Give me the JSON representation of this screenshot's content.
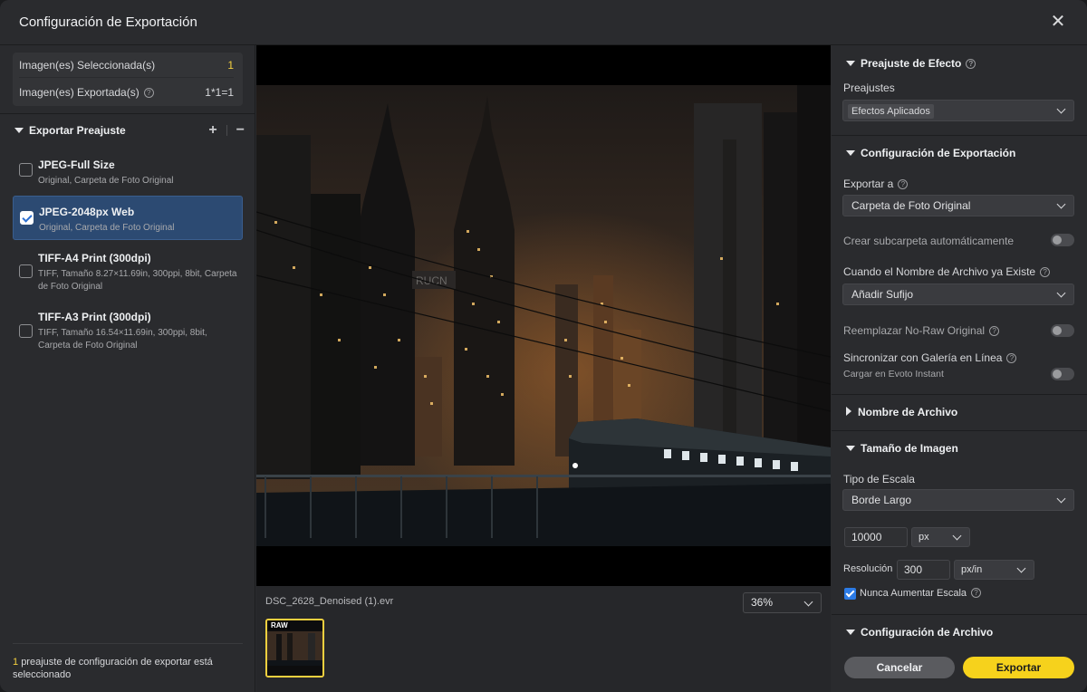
{
  "window": {
    "title": "Configuración de Exportación"
  },
  "selection": {
    "selected_label": "Imagen(es) Seleccionada(s)",
    "selected_value": "1",
    "exported_label": "Imagen(es) Exportada(s)",
    "exported_value": "1*1=1"
  },
  "presets": {
    "header": "Exportar Preajuste",
    "items": [
      {
        "name": "JPEG-Full Size",
        "desc": "Original, Carpeta de Foto Original",
        "checked": false
      },
      {
        "name": "JPEG-2048px Web",
        "desc": "Original, Carpeta de Foto Original",
        "checked": true
      },
      {
        "name": "TIFF-A4 Print (300dpi)",
        "desc": "TIFF, Tamaño 8.27×11.69in, 300ppi, 8bit, Carpeta de Foto Original",
        "checked": false
      },
      {
        "name": "TIFF-A3 Print (300dpi)",
        "desc": "TIFF, Tamaño 16.54×11.69in, 300ppi, 8bit, Carpeta de Foto Original",
        "checked": false
      }
    ],
    "footer_count": "1",
    "footer_text": "preajuste de configuración de exportar está seleccionado"
  },
  "viewer": {
    "filename": "DSC_2628_Denoised (1).evr",
    "zoom": "36%",
    "thumb_badge": "RAW"
  },
  "effect": {
    "header": "Preajuste de Efecto",
    "presets_label": "Preajustes",
    "presets_value": "Efectos Aplicados"
  },
  "export_config": {
    "header": "Configuración de Exportación",
    "export_to_label": "Exportar a",
    "export_to_value": "Carpeta de Foto Original",
    "subfolder_label": "Crear subcarpeta automáticamente",
    "exists_label": "Cuando el Nombre de Archivo ya Existe",
    "exists_value": "Añadir Sufijo",
    "replace_label": "Reemplazar No-Raw Original",
    "sync_label": "Sincronizar con Galería en Línea",
    "sync_sub": "Cargar en Evoto Instant"
  },
  "file_name": {
    "header": "Nombre de Archivo"
  },
  "image_size": {
    "header": "Tamaño de Imagen",
    "scale_type_label": "Tipo de Escala",
    "scale_type_value": "Borde Largo",
    "size_value": "10000",
    "size_unit": "px",
    "resolution_label": "Resolución",
    "resolution_value": "300",
    "resolution_unit": "px/in",
    "never_enlarge_label": "Nunca Aumentar Escala"
  },
  "file_config": {
    "header": "Configuración de Archivo"
  },
  "buttons": {
    "cancel": "Cancelar",
    "export": "Exportar"
  },
  "photo_sign": "RUCN"
}
